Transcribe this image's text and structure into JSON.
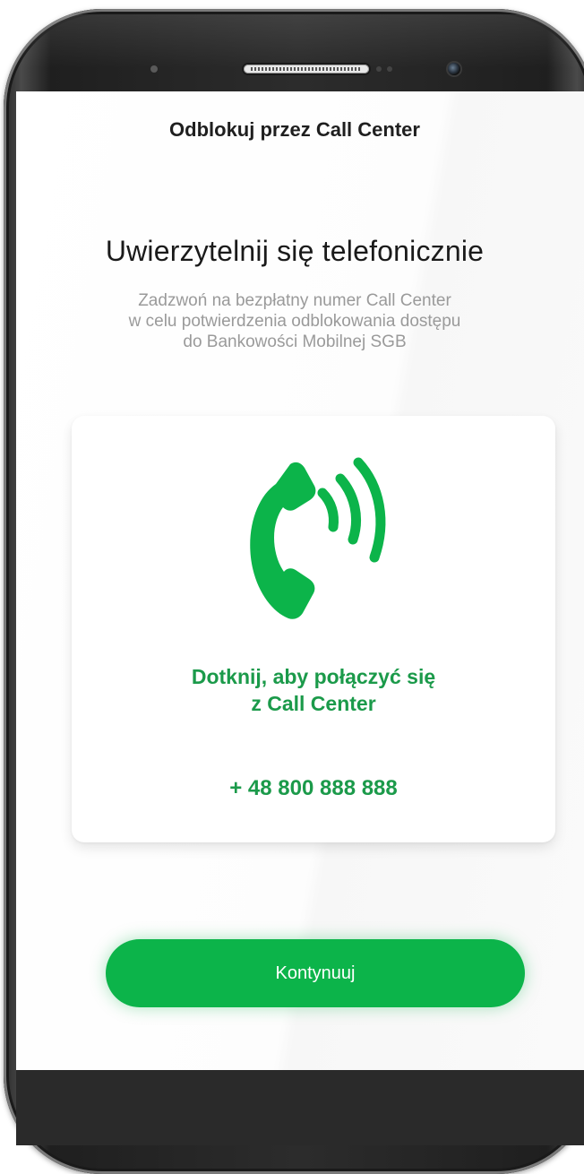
{
  "header": {
    "title": "Odblokuj przez Call Center"
  },
  "main": {
    "headline": "Uwierzytelnij się telefonicznie",
    "description": [
      "Zadzwoń na bezpłatny numer Call Center",
      "w celu potwierdzenia odblokowania dostępu",
      "do Bankowości Mobilnej SGB"
    ]
  },
  "call_card": {
    "icon": "phone-call-icon",
    "cta_lines": [
      "Dotknij, aby połączyć się",
      "z Call Center"
    ],
    "phone_number": "+ 48 800 888 888"
  },
  "footer": {
    "continue_label": "Kontynuuj"
  },
  "colors": {
    "accent_green": "#0cb44a",
    "text_green": "#1b9a4a",
    "muted_text": "#9a9a9a"
  }
}
